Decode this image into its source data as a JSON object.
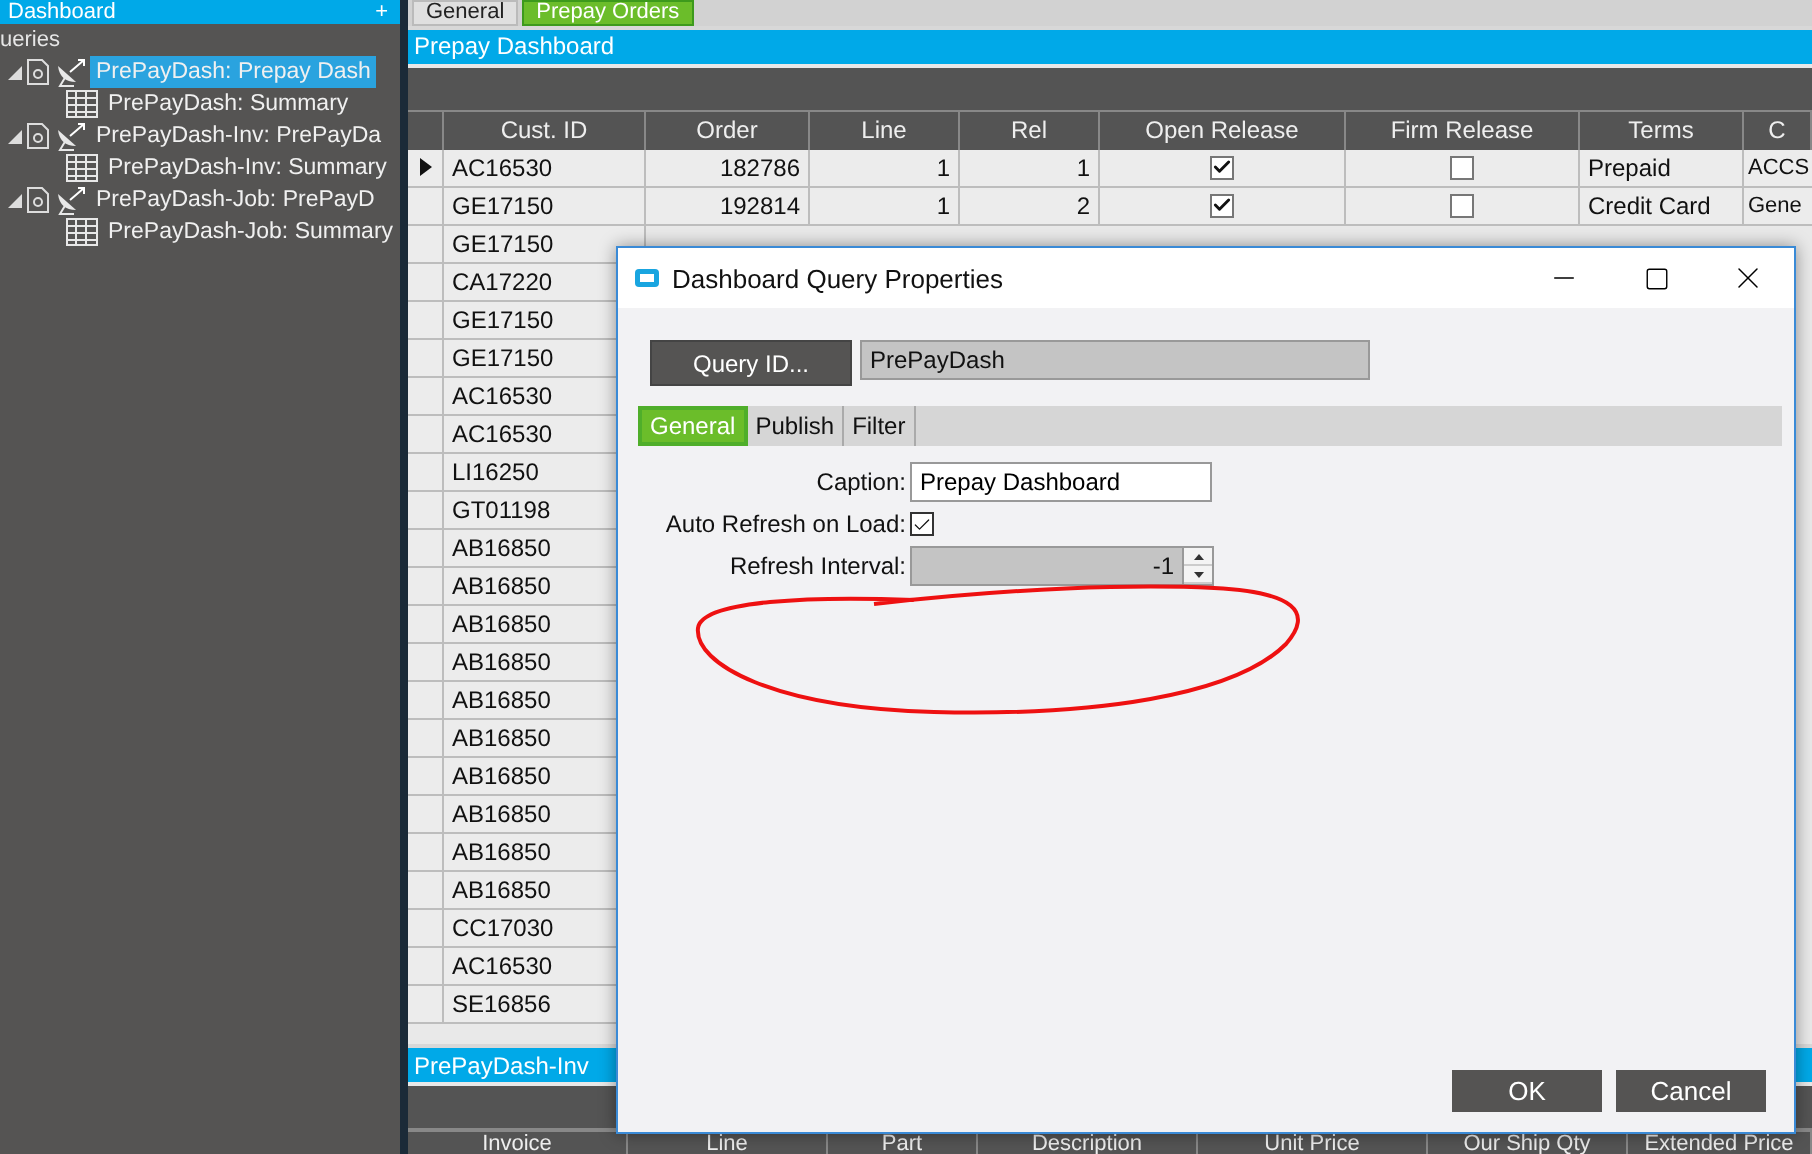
{
  "sidebar": {
    "title": "Dashboard",
    "add_label": "+",
    "section": "ueries",
    "items": [
      {
        "label": "PrePayDash: Prepay Dash",
        "selected": true,
        "expanded": true,
        "children": [
          {
            "label": "PrePayDash: Summary",
            "selected": false
          }
        ]
      },
      {
        "label": "PrePayDash-Inv: PrePayDa",
        "selected": false,
        "expanded": true,
        "children": [
          {
            "label": "PrePayDash-Inv: Summary",
            "selected": false
          }
        ]
      },
      {
        "label": "PrePayDash-Job: PrePayD",
        "selected": false,
        "expanded": true,
        "children": [
          {
            "label": "PrePayDash-Job: Summary",
            "selected": false
          }
        ]
      }
    ]
  },
  "tabs": [
    {
      "label": "General",
      "selected": false
    },
    {
      "label": "Prepay Orders",
      "selected": true
    }
  ],
  "panel_title": "Prepay Dashboard",
  "table": {
    "columns": [
      "Cust. ID",
      "Order",
      "Line",
      "Rel",
      "Open Release",
      "Firm Release",
      "Terms",
      "C"
    ],
    "rows": [
      {
        "kind": "full",
        "current": true,
        "cust_id": "AC16530",
        "order": "182786",
        "line": "1",
        "rel": "1",
        "open_release": true,
        "firm_release": false,
        "terms": "Prepaid",
        "column_9": "ACCS"
      },
      {
        "kind": "full",
        "current": false,
        "cust_id": "GE17150",
        "order": "192814",
        "line": "1",
        "rel": "2",
        "open_release": true,
        "firm_release": false,
        "terms": "Credit Card",
        "column_9": "Gene"
      },
      {
        "kind": "partial",
        "current": false,
        "cust_id": "GE17150"
      },
      {
        "kind": "partial",
        "current": false,
        "cust_id": "CA17220"
      },
      {
        "kind": "partial",
        "current": false,
        "cust_id": "GE17150"
      },
      {
        "kind": "partial",
        "current": false,
        "cust_id": "GE17150"
      },
      {
        "kind": "partial",
        "current": false,
        "cust_id": "AC16530"
      },
      {
        "kind": "partial",
        "current": false,
        "cust_id": "AC16530"
      },
      {
        "kind": "partial",
        "current": false,
        "cust_id": "LI16250"
      },
      {
        "kind": "partial",
        "current": false,
        "cust_id": "GT01198"
      },
      {
        "kind": "partial",
        "current": false,
        "cust_id": "AB16850"
      },
      {
        "kind": "partial",
        "current": false,
        "cust_id": "AB16850"
      },
      {
        "kind": "partial",
        "current": false,
        "cust_id": "AB16850"
      },
      {
        "kind": "partial",
        "current": false,
        "cust_id": "AB16850"
      },
      {
        "kind": "partial",
        "current": false,
        "cust_id": "AB16850"
      },
      {
        "kind": "partial",
        "current": false,
        "cust_id": "AB16850"
      },
      {
        "kind": "partial",
        "current": false,
        "cust_id": "AB16850"
      },
      {
        "kind": "partial",
        "current": false,
        "cust_id": "AB16850"
      },
      {
        "kind": "partial",
        "current": false,
        "cust_id": "AB16850"
      },
      {
        "kind": "partial",
        "current": false,
        "cust_id": "AB16850"
      },
      {
        "kind": "partial",
        "current": false,
        "cust_id": "CC17030"
      },
      {
        "kind": "partial",
        "current": false,
        "cust_id": "AC16530"
      },
      {
        "kind": "partial",
        "current": false,
        "cust_id": "SE16856"
      }
    ]
  },
  "bottom_panel": {
    "title": "PrePayDash-Inv",
    "columns": [
      "Invoice",
      "Line",
      "Part",
      "Description",
      "Unit Price",
      "Our Ship Qty",
      "Extended Price"
    ]
  },
  "dialog": {
    "title": "Dashboard Query Properties",
    "query_button": "Query ID...",
    "query_value": "PrePayDash",
    "tabs": [
      {
        "label": "General",
        "selected": true
      },
      {
        "label": "Publish",
        "selected": false
      },
      {
        "label": "Filter",
        "selected": false
      }
    ],
    "caption_label": "Caption:",
    "caption_value": "Prepay Dashboard",
    "auto_refresh_label": "Auto Refresh on Load:",
    "auto_refresh_checked": true,
    "interval_label": "Refresh Interval:",
    "interval_value": "-1",
    "interval_disabled": true,
    "buttons": [
      "OK",
      "Cancel"
    ]
  }
}
